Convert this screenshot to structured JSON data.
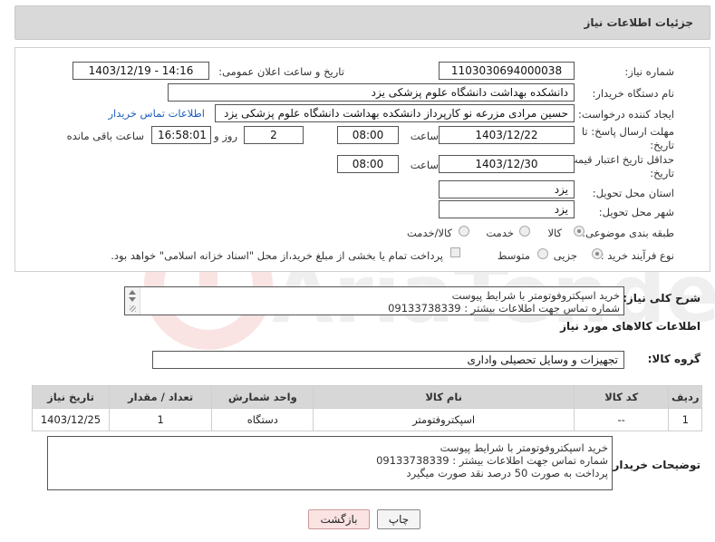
{
  "header": {
    "title": "جزئیات اطلاعات نیاز"
  },
  "form": {
    "need_number_label": "شماره نیاز:",
    "need_number": "1103030694000038",
    "announce_label": "تاریخ و ساعت اعلان عمومی:",
    "announce_value": "1403/12/19 - 14:16",
    "buyer_org_label": "نام دستگاه خریدار:",
    "buyer_org": "دانشکده بهداشت دانشگاه علوم پزشکی یزد",
    "creator_label": "ایجاد کننده درخواست:",
    "creator": "حسین مرادی مزرعه نو کارپرداز دانشکده بهداشت دانشگاه علوم پزشکی یزد",
    "contact_link": "اطلاعات تماس خریدار",
    "deadline_label_1": "مهلت ارسال پاسخ: تا",
    "deadline_label_2": "تاریخ:",
    "deadline_date": "1403/12/22",
    "hour_label": "ساعت",
    "deadline_time": "08:00",
    "days_value": "2",
    "days_label": "روز و",
    "remaining_time": "16:58:01",
    "remaining_label": "ساعت باقی مانده",
    "min_valid_label_1": "حداقل تاریخ اعتبار قیمت: تا",
    "min_valid_label_2": "تاریخ:",
    "min_valid_date": "1403/12/30",
    "min_valid_time": "08:00",
    "province_label": "استان محل تحویل:",
    "province": "یزد",
    "city_label": "شهر محل تحویل:",
    "city": "یزد",
    "category_label": "طبقه بندی موضوعی:",
    "category_options": [
      "کالا",
      "خدمت",
      "کالا/خدمت"
    ],
    "process_label": "نوع فرآیند خرید :",
    "process_options": [
      "جزیی",
      "متوسط"
    ],
    "payment_note": "پرداخت تمام یا بخشی از مبلغ خرید،از محل \"اسناد خزانه اسلامی\" خواهد بود.",
    "description_label": "شرح کلی نیاز:",
    "description_lines": [
      "خرید اسپکتروفوتومتر با شرایط پیوست",
      "شماره تماس جهت اطلاعات بیشتر : 09133738339"
    ]
  },
  "goods": {
    "section_title": "اطلاعات کالاهای مورد نیاز",
    "group_label": "گروه کالا:",
    "group_value": "تجهیزات و وسایل تحصیلی واداری",
    "columns": [
      "ردیف",
      "کد کالا",
      "نام کالا",
      "واحد شمارش",
      "تعداد / مقدار",
      "تاریخ نیاز"
    ],
    "rows": [
      [
        "1",
        "--",
        "اسپکتروفتومتر",
        "دستگاه",
        "1",
        "1403/12/25"
      ]
    ]
  },
  "buyer_notes": {
    "label": "توضیحات خریدار:",
    "lines": [
      "خرید اسپکتروفوتومتر با شرایط پیوست",
      "شماره تماس جهت اطلاعات بیشتر : 09133738339",
      "پرداخت به صورت 50 درصد نقد صورت میگیرد"
    ]
  },
  "buttons": {
    "print": "چاپ",
    "back": "بازگشت"
  },
  "watermark": {
    "text": "AriaTender.neT"
  },
  "colors": {
    "link": "#1f5fbf",
    "header_bg": "#d9d9d9",
    "back_button_bg": "#fbe3e3"
  }
}
